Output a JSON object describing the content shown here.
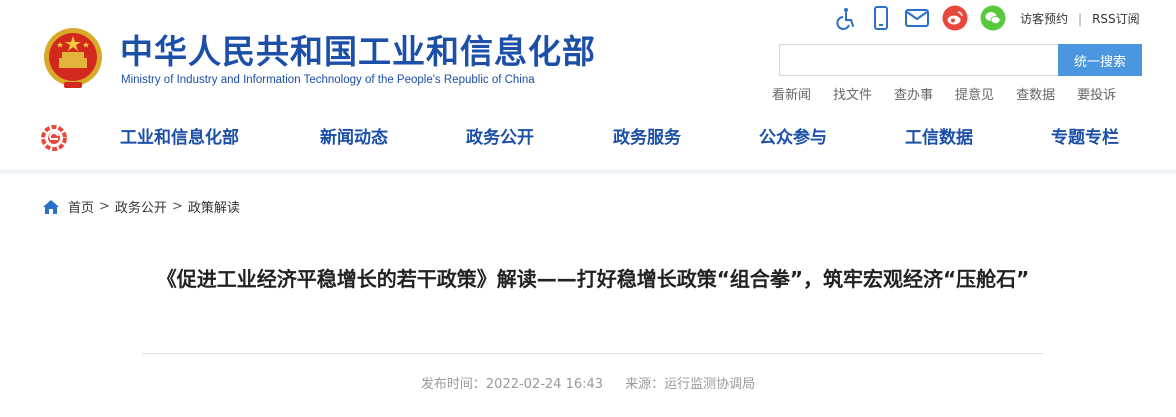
{
  "header": {
    "ministry_name_cn": "中华人民共和国工业和信息化部",
    "ministry_name_en": "Ministry of Industry and Information Technology of the People's Republic of China",
    "top_icons": [
      "accessibility-icon",
      "mobile-icon",
      "mail-icon",
      "weibo-icon",
      "wechat-icon"
    ],
    "top_links": {
      "visit": "访客预约",
      "separator": "|",
      "rss": "RSS订阅"
    },
    "search": {
      "placeholder": "",
      "button_label": "统一搜索"
    },
    "quick_links": [
      "看新闻",
      "找文件",
      "查办事",
      "提意见",
      "查数据",
      "要投诉"
    ]
  },
  "nav": {
    "items": [
      "工业和信息化部",
      "新闻动态",
      "政务公开",
      "政务服务",
      "公众参与",
      "工信数据",
      "专题专栏"
    ]
  },
  "breadcrumb": {
    "items": [
      "首页",
      "政务公开",
      "政策解读"
    ],
    "separator": ">"
  },
  "article": {
    "title": "《促进工业经济平稳增长的若干政策》解读——打好稳增长政策“组合拳”，筑牢宏观经济“压舱石”",
    "publish_label": "发布时间：",
    "publish_time": "2022-02-24 16:43",
    "source_label": "来源：",
    "source": "运行监测协调局"
  },
  "colors": {
    "brand_blue": "#1b4fa8",
    "search_button": "#4a97e0",
    "weibo": "#e8483c",
    "wechat": "#5ac83c",
    "icon_blue": "#2a6fc9"
  }
}
